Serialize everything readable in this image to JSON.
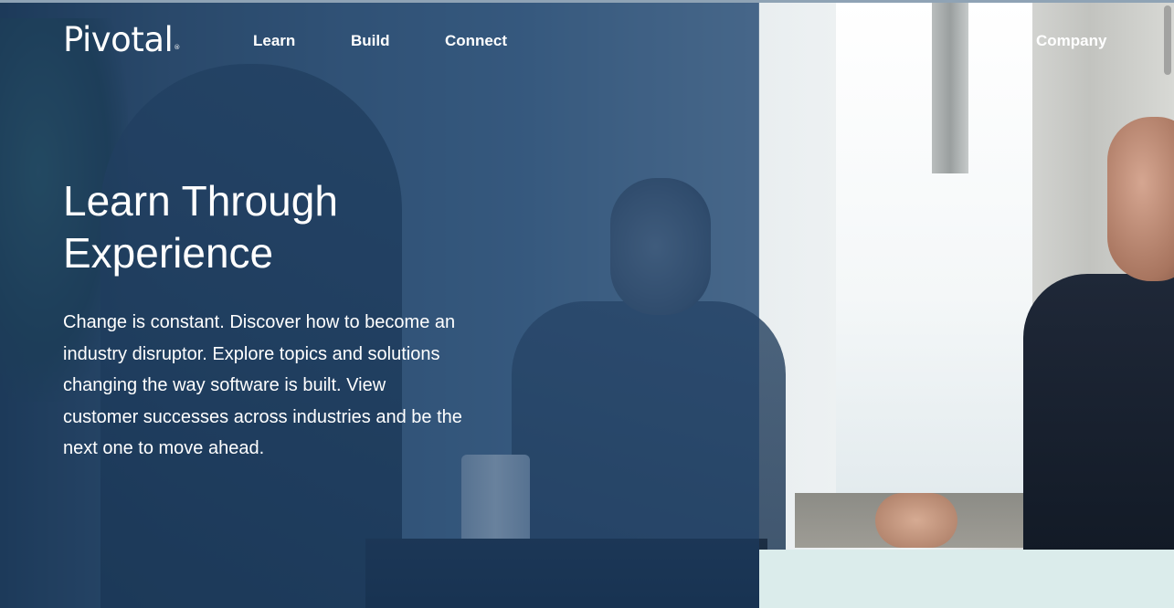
{
  "nav": {
    "logo": "Pivotal",
    "logo_mark": "®",
    "links": [
      "Learn",
      "Build",
      "Connect"
    ],
    "company": "Company"
  },
  "hero": {
    "title_line1": "Learn Through",
    "title_line2": "Experience",
    "description": "Change is constant. Discover how to become an industry disruptor. Explore topics and solutions changing the way software is built. View customer successes across industries and be the next one to move ahead."
  },
  "colors": {
    "overlay": "#1c3e66",
    "text": "#ffffff",
    "bottom_panel": "#dbeceb"
  }
}
